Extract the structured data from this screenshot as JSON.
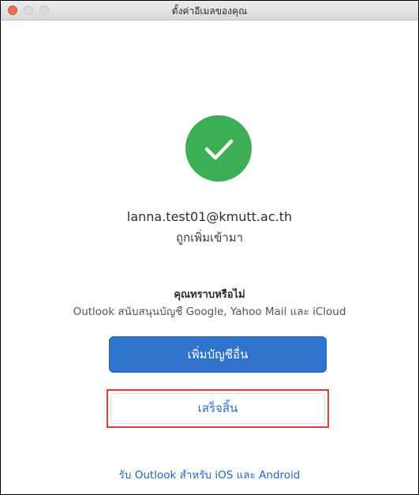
{
  "window": {
    "title": "ตั้งค่าอีเมลของคุณ"
  },
  "status_icon": "checkmark-circle-icon",
  "account": {
    "email": "lanna.test01@kmutt.ac.th",
    "status": "ถูกเพิ่มเข้ามา"
  },
  "info": {
    "heading": "คุณทราบหรือไม่",
    "body": "Outlook สนับสนุนบัญชี Google, Yahoo Mail และ iCloud"
  },
  "buttons": {
    "add_account": "เพิ่มบัญชีอื่น",
    "done": "เสร็จสิ้น"
  },
  "links": {
    "mobile": "รับ Outlook สำหรับ iOS และ Android"
  },
  "colors": {
    "success_green": "#3cae55",
    "primary_blue": "#2f73cc",
    "link_blue": "#2467c4",
    "highlight_red": "#e03c3c"
  }
}
